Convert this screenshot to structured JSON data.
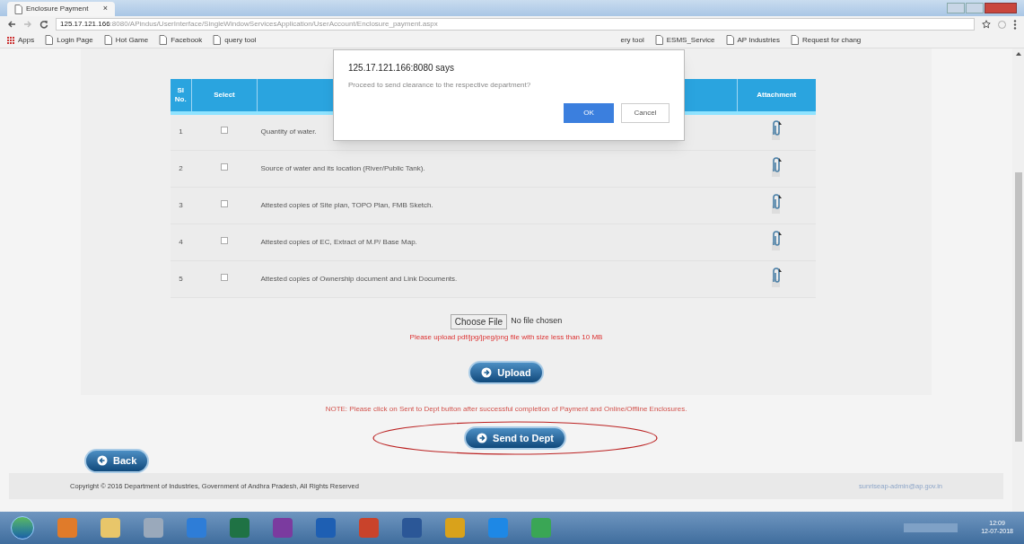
{
  "browser": {
    "tab_title": "Enclosure Payment",
    "tab_close": "×",
    "address_host": "125.17.121.166",
    "address_path": ":8080/APindus/UserInterface/SingleWindowServicesApplication/UserAccount/Enclosure_payment.aspx",
    "bookmarks_left": [
      "Apps",
      "Login Page",
      "Hot Game",
      "Facebook",
      "query tool"
    ],
    "bookmarks_right": [
      "ery tool",
      "ESMS_Service",
      "AP Industries",
      "Request for chang"
    ]
  },
  "dialog": {
    "title": "125.17.121.166:8080 says",
    "message": "Proceed to send clearance to the respective department?",
    "ok": "OK",
    "cancel": "Cancel"
  },
  "table": {
    "columns": [
      "Sl No.",
      "Select",
      "Attachment"
    ],
    "rows": [
      {
        "no": "1",
        "checked": false,
        "description": "Quantity of water."
      },
      {
        "no": "2",
        "checked": false,
        "description": "Source of water and its location (River/Public Tank)."
      },
      {
        "no": "3",
        "checked": false,
        "description": "Attested copies of Site plan, TOPO Plan, FMB Sketch."
      },
      {
        "no": "4",
        "checked": false,
        "description": "Attested copies of EC, Extract of M.P/ Base Map."
      },
      {
        "no": "5",
        "checked": false,
        "description": "Attested copies of Ownership document and Link Documents."
      }
    ]
  },
  "upload": {
    "choose_button": "Choose File",
    "file_status": "No file chosen",
    "hint": "Please upload pdf/jpg/jpeg/png file with size less than 10 MB",
    "upload_button": "Upload"
  },
  "note": "NOTE: Please click on Sent to Dept button after successful completion of Payment and Online/Offline Enclosures.",
  "send_button": "Send to Dept",
  "back_button": "Back",
  "footer": {
    "copyright": "Copyright © 2016 Department of Industries, Government of Andhra Pradesh, All Rights Reserved",
    "email": "sunriseap-admin@ap.gov.in"
  },
  "taskbar": {
    "time": "12:09",
    "date": "12-07-2018"
  }
}
